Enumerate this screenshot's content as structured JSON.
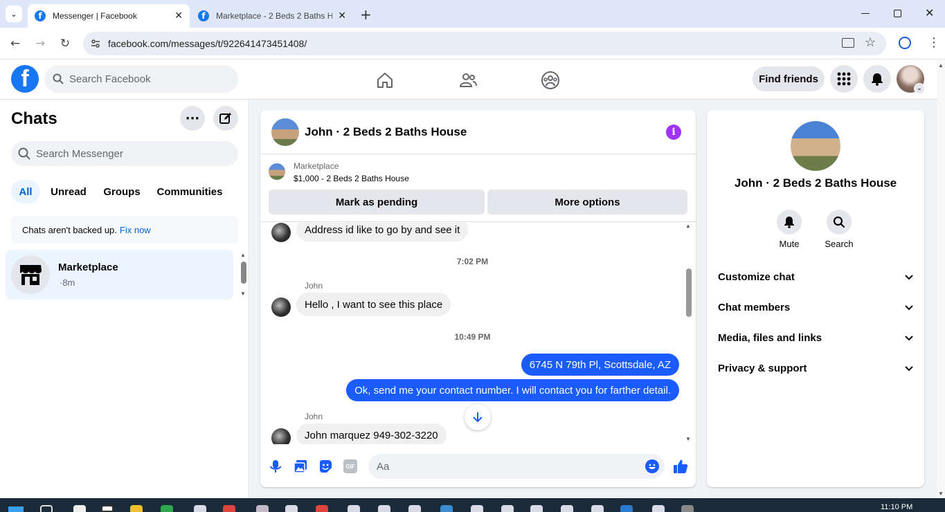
{
  "browser": {
    "tabs": [
      {
        "label": "Messenger | Facebook",
        "active": true
      },
      {
        "label": "Marketplace - 2 Beds 2 Baths H",
        "active": false
      }
    ],
    "url": "facebook.com/messages/t/922641473451408/"
  },
  "fb": {
    "search_placeholder": "Search Facebook",
    "find_friends": "Find friends",
    "brand_color": "#1877f2"
  },
  "chats": {
    "title": "Chats",
    "search_placeholder": "Search Messenger",
    "filters": [
      "All",
      "Unread",
      "Groups",
      "Communities"
    ],
    "backup_text": "Chats aren't backed up.",
    "backup_link": "Fix now",
    "items": [
      {
        "name": "Marketplace",
        "meta": "·8m"
      }
    ]
  },
  "conversation": {
    "title": "John · 2 Beds 2 Baths House",
    "listing_source": "Marketplace",
    "listing_title": "$1,000 - 2 Beds 2 Baths House",
    "mark_pending": "Mark as pending",
    "more_options": "More options",
    "messages": [
      {
        "type": "in",
        "text": "Address id like to go by and see it"
      },
      {
        "type": "time",
        "text": "7:02 PM"
      },
      {
        "type": "sender",
        "text": "John"
      },
      {
        "type": "in",
        "text": "Hello , I want to see this place"
      },
      {
        "type": "time",
        "text": "10:49 PM"
      },
      {
        "type": "out",
        "text": "6745 N 79th Pl, Scottsdale, AZ"
      },
      {
        "type": "out",
        "text": "Ok, send me your contact number. I will contact you for farther detail."
      },
      {
        "type": "sender",
        "text": "John"
      },
      {
        "type": "in",
        "text": "John marquez 949-302-3220"
      }
    ],
    "composer_placeholder": "Aa",
    "accent_color": "#1a5cff",
    "info_color": "#a033ff"
  },
  "info": {
    "name": "John · 2 Beds 2 Baths House",
    "actions": [
      {
        "label": "Mute",
        "icon": "bell-icon"
      },
      {
        "label": "Search",
        "icon": "search-icon"
      }
    ],
    "sections": [
      "Customize chat",
      "Chat members",
      "Media, files and links",
      "Privacy & support"
    ]
  },
  "taskbar": {
    "time": "11:10 PM"
  }
}
